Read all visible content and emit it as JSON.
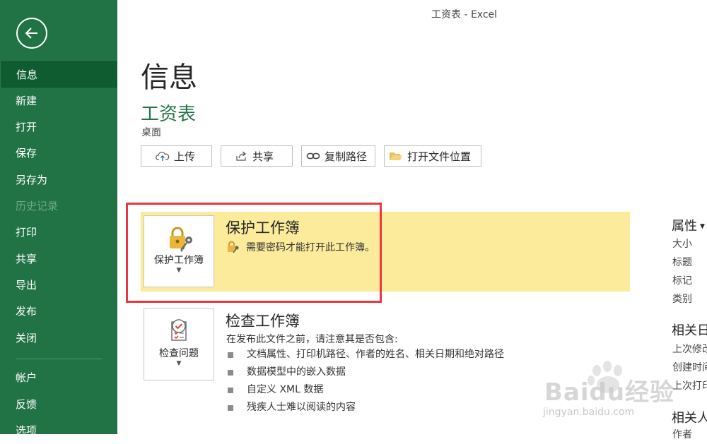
{
  "window": {
    "title": "工资表 - Excel"
  },
  "sidebar": {
    "items": [
      {
        "label": "信息",
        "active": true
      },
      {
        "label": "新建"
      },
      {
        "label": "打开"
      },
      {
        "label": "保存"
      },
      {
        "label": "另存为"
      },
      {
        "label": "历史记录",
        "disabled": true
      },
      {
        "label": "打印"
      },
      {
        "label": "共享"
      },
      {
        "label": "导出"
      },
      {
        "label": "发布"
      },
      {
        "label": "关闭"
      },
      {
        "label": "帐户"
      },
      {
        "label": "反馈"
      },
      {
        "label": "选项"
      }
    ]
  },
  "main": {
    "title": "信息",
    "file_name": "工资表",
    "file_location": "桌面",
    "actions": {
      "upload": "上传",
      "share": "共享",
      "copy_path": "复制路径",
      "open_location": "打开文件位置"
    }
  },
  "protect": {
    "tile_label": "保护工作簿",
    "heading": "保护工作簿",
    "description": "需要密码才能打开此工作簿。"
  },
  "inspect": {
    "tile_label": "检查问题",
    "heading": "检查工作簿",
    "description": "在发布此文件之前，请注意其是否包含:",
    "bullets": [
      "文档属性、打印机路径、作者的姓名、相关日期和绝对路径",
      "数据模型中的嵌入数据",
      "自定义 XML 数据",
      "残疾人士难以阅读的内容"
    ]
  },
  "properties": {
    "heading": "属性",
    "fields": [
      "大小",
      "标题",
      "标记",
      "类别"
    ],
    "dates_heading": "相关日",
    "date_fields": [
      "上次修改",
      "创建时间",
      "上次打印"
    ],
    "people_heading": "相关人",
    "people_fields": [
      "作者"
    ]
  },
  "watermark": {
    "brand": "Baidu经验",
    "url": "jingyan.baidu.com"
  },
  "colors": {
    "sidebar": "#217346",
    "accent": "#217346",
    "highlight": "#fbeb9b",
    "annotation": "#e8383d"
  }
}
